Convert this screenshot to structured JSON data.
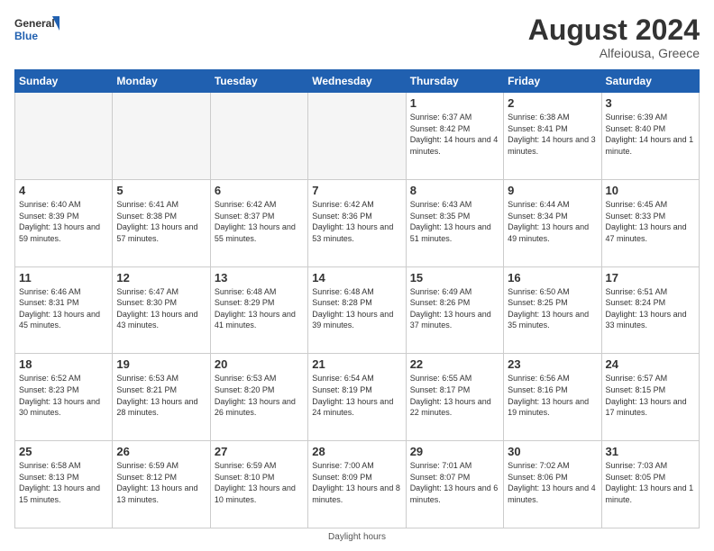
{
  "logo": {
    "text_general": "General",
    "text_blue": "Blue"
  },
  "header": {
    "month_year": "August 2024",
    "location": "Alfeiousa, Greece"
  },
  "weekdays": [
    "Sunday",
    "Monday",
    "Tuesday",
    "Wednesday",
    "Thursday",
    "Friday",
    "Saturday"
  ],
  "footer": {
    "note": "Daylight hours"
  },
  "weeks": [
    [
      {
        "day": "",
        "sunrise": "",
        "sunset": "",
        "daylight": "",
        "empty": true
      },
      {
        "day": "",
        "sunrise": "",
        "sunset": "",
        "daylight": "",
        "empty": true
      },
      {
        "day": "",
        "sunrise": "",
        "sunset": "",
        "daylight": "",
        "empty": true
      },
      {
        "day": "",
        "sunrise": "",
        "sunset": "",
        "daylight": "",
        "empty": true
      },
      {
        "day": "1",
        "sunrise": "Sunrise: 6:37 AM",
        "sunset": "Sunset: 8:42 PM",
        "daylight": "Daylight: 14 hours and 4 minutes.",
        "empty": false
      },
      {
        "day": "2",
        "sunrise": "Sunrise: 6:38 AM",
        "sunset": "Sunset: 8:41 PM",
        "daylight": "Daylight: 14 hours and 3 minutes.",
        "empty": false
      },
      {
        "day": "3",
        "sunrise": "Sunrise: 6:39 AM",
        "sunset": "Sunset: 8:40 PM",
        "daylight": "Daylight: 14 hours and 1 minute.",
        "empty": false
      }
    ],
    [
      {
        "day": "4",
        "sunrise": "Sunrise: 6:40 AM",
        "sunset": "Sunset: 8:39 PM",
        "daylight": "Daylight: 13 hours and 59 minutes.",
        "empty": false
      },
      {
        "day": "5",
        "sunrise": "Sunrise: 6:41 AM",
        "sunset": "Sunset: 8:38 PM",
        "daylight": "Daylight: 13 hours and 57 minutes.",
        "empty": false
      },
      {
        "day": "6",
        "sunrise": "Sunrise: 6:42 AM",
        "sunset": "Sunset: 8:37 PM",
        "daylight": "Daylight: 13 hours and 55 minutes.",
        "empty": false
      },
      {
        "day": "7",
        "sunrise": "Sunrise: 6:42 AM",
        "sunset": "Sunset: 8:36 PM",
        "daylight": "Daylight: 13 hours and 53 minutes.",
        "empty": false
      },
      {
        "day": "8",
        "sunrise": "Sunrise: 6:43 AM",
        "sunset": "Sunset: 8:35 PM",
        "daylight": "Daylight: 13 hours and 51 minutes.",
        "empty": false
      },
      {
        "day": "9",
        "sunrise": "Sunrise: 6:44 AM",
        "sunset": "Sunset: 8:34 PM",
        "daylight": "Daylight: 13 hours and 49 minutes.",
        "empty": false
      },
      {
        "day": "10",
        "sunrise": "Sunrise: 6:45 AM",
        "sunset": "Sunset: 8:33 PM",
        "daylight": "Daylight: 13 hours and 47 minutes.",
        "empty": false
      }
    ],
    [
      {
        "day": "11",
        "sunrise": "Sunrise: 6:46 AM",
        "sunset": "Sunset: 8:31 PM",
        "daylight": "Daylight: 13 hours and 45 minutes.",
        "empty": false
      },
      {
        "day": "12",
        "sunrise": "Sunrise: 6:47 AM",
        "sunset": "Sunset: 8:30 PM",
        "daylight": "Daylight: 13 hours and 43 minutes.",
        "empty": false
      },
      {
        "day": "13",
        "sunrise": "Sunrise: 6:48 AM",
        "sunset": "Sunset: 8:29 PM",
        "daylight": "Daylight: 13 hours and 41 minutes.",
        "empty": false
      },
      {
        "day": "14",
        "sunrise": "Sunrise: 6:48 AM",
        "sunset": "Sunset: 8:28 PM",
        "daylight": "Daylight: 13 hours and 39 minutes.",
        "empty": false
      },
      {
        "day": "15",
        "sunrise": "Sunrise: 6:49 AM",
        "sunset": "Sunset: 8:26 PM",
        "daylight": "Daylight: 13 hours and 37 minutes.",
        "empty": false
      },
      {
        "day": "16",
        "sunrise": "Sunrise: 6:50 AM",
        "sunset": "Sunset: 8:25 PM",
        "daylight": "Daylight: 13 hours and 35 minutes.",
        "empty": false
      },
      {
        "day": "17",
        "sunrise": "Sunrise: 6:51 AM",
        "sunset": "Sunset: 8:24 PM",
        "daylight": "Daylight: 13 hours and 33 minutes.",
        "empty": false
      }
    ],
    [
      {
        "day": "18",
        "sunrise": "Sunrise: 6:52 AM",
        "sunset": "Sunset: 8:23 PM",
        "daylight": "Daylight: 13 hours and 30 minutes.",
        "empty": false
      },
      {
        "day": "19",
        "sunrise": "Sunrise: 6:53 AM",
        "sunset": "Sunset: 8:21 PM",
        "daylight": "Daylight: 13 hours and 28 minutes.",
        "empty": false
      },
      {
        "day": "20",
        "sunrise": "Sunrise: 6:53 AM",
        "sunset": "Sunset: 8:20 PM",
        "daylight": "Daylight: 13 hours and 26 minutes.",
        "empty": false
      },
      {
        "day": "21",
        "sunrise": "Sunrise: 6:54 AM",
        "sunset": "Sunset: 8:19 PM",
        "daylight": "Daylight: 13 hours and 24 minutes.",
        "empty": false
      },
      {
        "day": "22",
        "sunrise": "Sunrise: 6:55 AM",
        "sunset": "Sunset: 8:17 PM",
        "daylight": "Daylight: 13 hours and 22 minutes.",
        "empty": false
      },
      {
        "day": "23",
        "sunrise": "Sunrise: 6:56 AM",
        "sunset": "Sunset: 8:16 PM",
        "daylight": "Daylight: 13 hours and 19 minutes.",
        "empty": false
      },
      {
        "day": "24",
        "sunrise": "Sunrise: 6:57 AM",
        "sunset": "Sunset: 8:15 PM",
        "daylight": "Daylight: 13 hours and 17 minutes.",
        "empty": false
      }
    ],
    [
      {
        "day": "25",
        "sunrise": "Sunrise: 6:58 AM",
        "sunset": "Sunset: 8:13 PM",
        "daylight": "Daylight: 13 hours and 15 minutes.",
        "empty": false
      },
      {
        "day": "26",
        "sunrise": "Sunrise: 6:59 AM",
        "sunset": "Sunset: 8:12 PM",
        "daylight": "Daylight: 13 hours and 13 minutes.",
        "empty": false
      },
      {
        "day": "27",
        "sunrise": "Sunrise: 6:59 AM",
        "sunset": "Sunset: 8:10 PM",
        "daylight": "Daylight: 13 hours and 10 minutes.",
        "empty": false
      },
      {
        "day": "28",
        "sunrise": "Sunrise: 7:00 AM",
        "sunset": "Sunset: 8:09 PM",
        "daylight": "Daylight: 13 hours and 8 minutes.",
        "empty": false
      },
      {
        "day": "29",
        "sunrise": "Sunrise: 7:01 AM",
        "sunset": "Sunset: 8:07 PM",
        "daylight": "Daylight: 13 hours and 6 minutes.",
        "empty": false
      },
      {
        "day": "30",
        "sunrise": "Sunrise: 7:02 AM",
        "sunset": "Sunset: 8:06 PM",
        "daylight": "Daylight: 13 hours and 4 minutes.",
        "empty": false
      },
      {
        "day": "31",
        "sunrise": "Sunrise: 7:03 AM",
        "sunset": "Sunset: 8:05 PM",
        "daylight": "Daylight: 13 hours and 1 minute.",
        "empty": false
      }
    ]
  ]
}
